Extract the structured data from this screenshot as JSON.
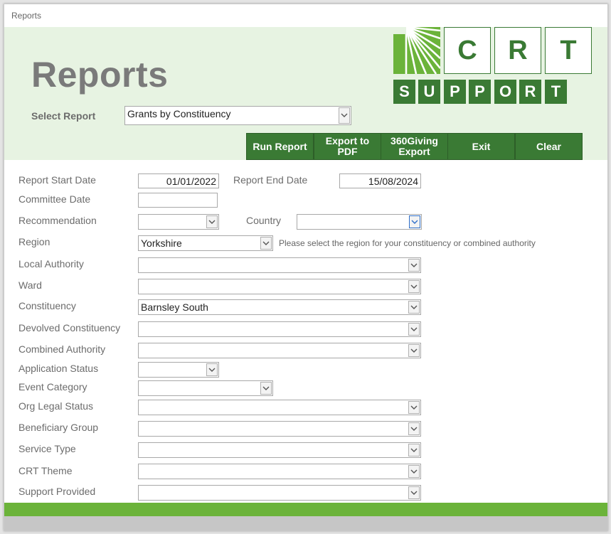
{
  "window": {
    "tab_title": "Reports"
  },
  "header": {
    "title": "Reports",
    "select_report_label": "Select Report",
    "select_report_value": "Grants by Constituency"
  },
  "buttons": {
    "run_report": "Run Report",
    "export_pdf": "Export to PDF",
    "export_360": "360Giving Export",
    "exit": "Exit",
    "clear": "Clear"
  },
  "logo": {
    "letters": [
      "C",
      "R",
      "T"
    ],
    "support": [
      "S",
      "U",
      "P",
      "P",
      "O",
      "R",
      "T"
    ],
    "colors": {
      "green": "#3a7a34",
      "light_green": "#6bb33a"
    }
  },
  "form": {
    "report_start_date": {
      "label": "Report Start Date",
      "value": "01/01/2022"
    },
    "report_end_date": {
      "label": "Report End Date",
      "value": "15/08/2024"
    },
    "committee_date": {
      "label": "Committee Date",
      "value": ""
    },
    "recommendation": {
      "label": "Recommendation",
      "value": ""
    },
    "country": {
      "label": "Country",
      "value": ""
    },
    "region": {
      "label": "Region",
      "value": "Yorkshire",
      "hint": "Please select the region for your constituency or combined authority"
    },
    "local_authority": {
      "label": "Local Authority",
      "value": ""
    },
    "ward": {
      "label": "Ward",
      "value": ""
    },
    "constituency": {
      "label": "Constituency",
      "value": "Barnsley South"
    },
    "devolved_constituency": {
      "label": "Devolved Constituency",
      "value": ""
    },
    "combined_authority": {
      "label": "Combined Authority",
      "value": ""
    },
    "application_status": {
      "label": "Application Status",
      "value": ""
    },
    "event_category": {
      "label": "Event Category",
      "value": ""
    },
    "org_legal_status": {
      "label": "Org Legal Status",
      "value": ""
    },
    "beneficiary_group": {
      "label": "Beneficiary Group",
      "value": ""
    },
    "service_type": {
      "label": "Service Type",
      "value": ""
    },
    "crt_theme": {
      "label": "CRT Theme",
      "value": ""
    },
    "support_provided": {
      "label": "Support Provided",
      "value": ""
    }
  }
}
